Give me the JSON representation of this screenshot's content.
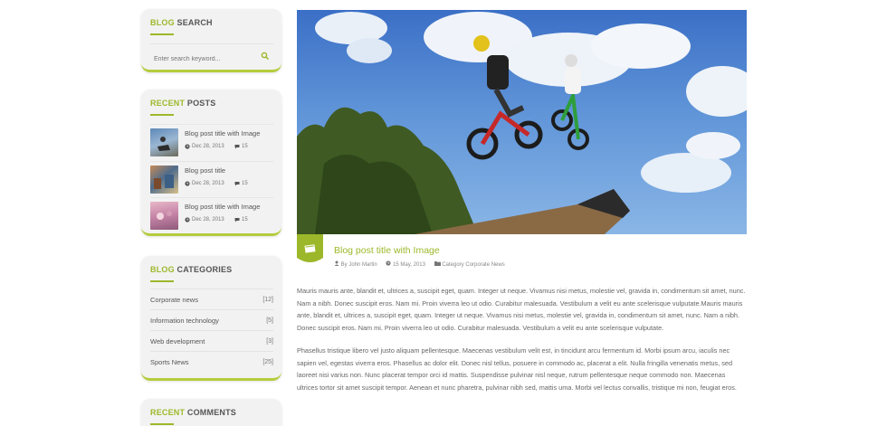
{
  "sidebar": {
    "search": {
      "title_accent": "BLOG",
      "title_rest": " SEARCH",
      "placeholder": "Enter search keyword...",
      "button_icon": "search-icon"
    },
    "recent_posts": {
      "title_accent": "RECENT",
      "title_rest": " POSTS",
      "items": [
        {
          "title": "Blog post title with Image",
          "date": "Dec 28, 2013",
          "comments": "15"
        },
        {
          "title": "Blog post title",
          "date": "Dec 28, 2013",
          "comments": "15"
        },
        {
          "title": "Blog post title with Image",
          "date": "Dec 28, 2013",
          "comments": "15"
        }
      ]
    },
    "categories": {
      "title_accent": "BLOG",
      "title_rest": " CATEGORIES",
      "items": [
        {
          "label": "Corporate news",
          "count": "[12]"
        },
        {
          "label": "Information technology",
          "count": "[5]"
        },
        {
          "label": "Web development",
          "count": "[3]"
        },
        {
          "label": "Sports News",
          "count": "[25]"
        }
      ]
    },
    "comments": {
      "title_accent": "RECENT",
      "title_rest": " COMMENTS"
    }
  },
  "post": {
    "title": "Blog post title with Image",
    "author_prefix": "By",
    "author": "John Martin",
    "date": "15 May, 2013",
    "category_prefix": "Category",
    "category": "Corporate News",
    "paragraphs": [
      "Mauris mauris ante, blandit et, ultrices a, suscipit eget, quam. Integer ut neque. Vivamus nisi metus, molestie vel, gravida in, condimentum sit amet, nunc. Nam a nibh. Donec suscipit eros. Nam mi. Proin viverra leo ut odio. Curabitur malesuada. Vestibulum a velit eu ante scelerisque vulputate.Mauris mauris ante, blandit et, ultrices a, suscipit eget, quam. Integer ut neque. Vivamus nisi metus, molestie vel, gravida in, condimentum sit amet, nunc. Nam a nibh. Donec suscipit eros. Nam mi. Proin viverra leo ut odio. Curabitur malesuada. Vestibulum a velit eu ante scelerisque vulputate.",
      "Phasellus tristique libero vel justo aliquam pellentesque. Maecenas vestibulum velit est, in tincidunt arcu fermentum id. Morbi ipsum arcu, iaculis nec sapien vel, egestas viverra eros. Phasellus ac dolor elit. Donec nisl tellus, posuere in commodo ac, placerat a elit. Nulla fringilla venenatis metus, sed laoreet nisi varius non. Nunc placerat tempor orci id mattis. Suspendisse pulvinar nisl neque, rutrum pellentesque neque commodo non. Maecenas ultrices tortor sit amet suscipit tempor. Aenean et nunc pharetra, pulvinar nibh sed, mattis uma. Morbi vel lectus convallis, tristique mi non, feugiat eros."
    ]
  },
  "colors": {
    "accent": "#9cb82a",
    "widget_bg": "#f2f2f2"
  }
}
